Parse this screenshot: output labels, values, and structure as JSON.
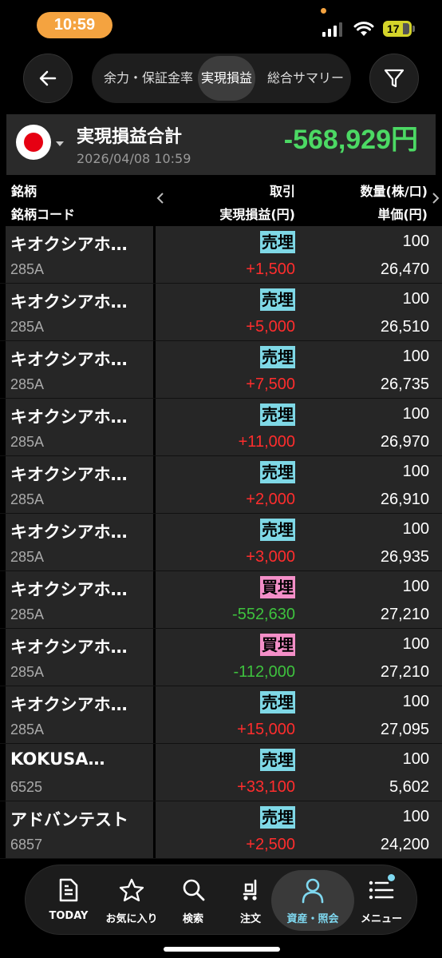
{
  "status_bar": {
    "time": "10:59",
    "battery": "17"
  },
  "tabs": [
    {
      "label": "余力・保証金率",
      "active": false
    },
    {
      "label": "実現損益",
      "active": true
    },
    {
      "label": "総合サマリー",
      "active": false
    }
  ],
  "summary": {
    "title": "実現損益合計",
    "date": "2026/04/08 10:59",
    "total": "-568,929円"
  },
  "headers": {
    "col1_top": "銘柄",
    "col1_bottom": "銘柄コード",
    "col2_top": "取引",
    "col2_bottom": "実現損益(円)",
    "col3_top": "数量(株/口)",
    "col3_bottom": "単価(円)"
  },
  "rows": [
    {
      "name": "キオクシアホ…",
      "code": "285A",
      "trade": "売埋",
      "pl": "+1,500",
      "qty": "100",
      "price": "26,470"
    },
    {
      "name": "キオクシアホ…",
      "code": "285A",
      "trade": "売埋",
      "pl": "+5,000",
      "qty": "100",
      "price": "26,510"
    },
    {
      "name": "キオクシアホ…",
      "code": "285A",
      "trade": "売埋",
      "pl": "+7,500",
      "qty": "100",
      "price": "26,735"
    },
    {
      "name": "キオクシアホ…",
      "code": "285A",
      "trade": "売埋",
      "pl": "+11,000",
      "qty": "100",
      "price": "26,970"
    },
    {
      "name": "キオクシアホ…",
      "code": "285A",
      "trade": "売埋",
      "pl": "+2,000",
      "qty": "100",
      "price": "26,910"
    },
    {
      "name": "キオクシアホ…",
      "code": "285A",
      "trade": "売埋",
      "pl": "+3,000",
      "qty": "100",
      "price": "26,935"
    },
    {
      "name": "キオクシアホ…",
      "code": "285A",
      "trade": "買埋",
      "pl": "-552,630",
      "qty": "100",
      "price": "27,210"
    },
    {
      "name": "キオクシアホ…",
      "code": "285A",
      "trade": "買埋",
      "pl": "-112,000",
      "qty": "100",
      "price": "27,210"
    },
    {
      "name": "キオクシアホ…",
      "code": "285A",
      "trade": "売埋",
      "pl": "+15,000",
      "qty": "100",
      "price": "27,095"
    },
    {
      "name": "KOKUSA…",
      "code": "6525",
      "trade": "売埋",
      "pl": "+33,100",
      "qty": "100",
      "price": "5,602"
    },
    {
      "name": "アドバンテスト",
      "code": "6857",
      "trade": "売埋",
      "pl": "+2,500",
      "qty": "100",
      "price": "24,200"
    }
  ],
  "colors": {
    "positive": "#ff2d2d",
    "negative": "#3ec23e",
    "sell_badge": "#7fd8e6",
    "buy_badge": "#f48fc8",
    "total": "#4cd964",
    "status_pill": "#f4a340"
  },
  "bottom_nav": [
    {
      "label": "TODAY",
      "icon": "document-icon"
    },
    {
      "label": "お気に入り",
      "icon": "star-icon"
    },
    {
      "label": "検索",
      "icon": "search-icon"
    },
    {
      "label": "注文",
      "icon": "cart-icon"
    },
    {
      "label": "資産・照会",
      "icon": "person-icon",
      "active": true
    },
    {
      "label": "メニュー",
      "icon": "menu-icon"
    }
  ]
}
